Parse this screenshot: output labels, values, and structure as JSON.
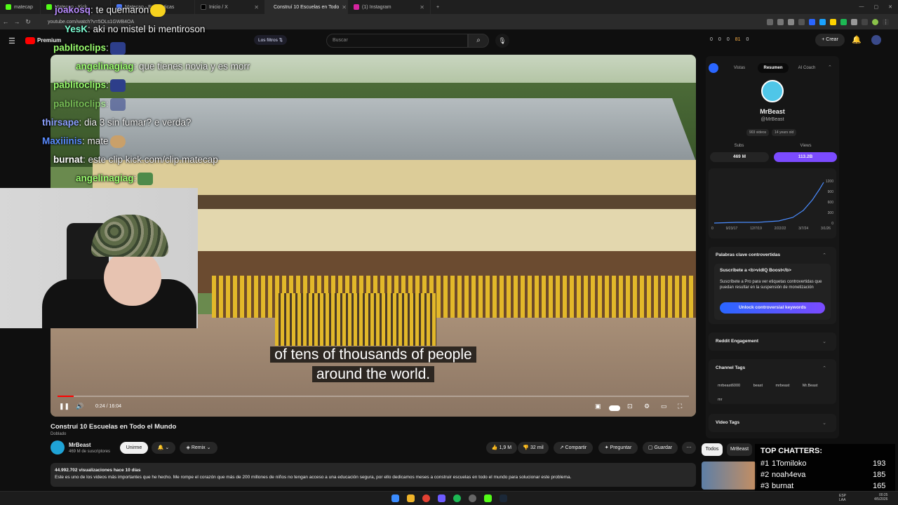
{
  "browser": {
    "tabs": [
      {
        "label": "matecap"
      },
      {
        "label": "Matecap - Kick"
      },
      {
        "label": "Matecap - Estadisticas"
      },
      {
        "label": "Inicio / X"
      },
      {
        "label": "Construí 10 Escuelas en Todo"
      },
      {
        "label": "(1) Instagram"
      }
    ],
    "url": "youtube.com/watch?v=5OLs1GWB4OA"
  },
  "youtube": {
    "logo_suffix": "Premium",
    "filters_label": "Los filtros",
    "search_placeholder": "Buscar",
    "create_label": "Crear",
    "stats": [
      "0",
      "0",
      "0",
      "81",
      "0"
    ]
  },
  "chat": [
    {
      "user": "joakosq",
      "text": ": te quemaron",
      "color": "#b98cff"
    },
    {
      "user": "YesK",
      "text": ": aki no mistel bi mentiroson",
      "color": "#7fffd4"
    },
    {
      "user": "pablitoclips",
      "text": ":",
      "color": "#9bff6f"
    },
    {
      "user": "angelinagiag",
      "text": ": que tienes novia y es morr",
      "color": "#9bff6f"
    },
    {
      "user": "pablitoclips",
      "text": ":",
      "color": "#9bff6f"
    },
    {
      "user": "pablitoclips",
      "text": ":",
      "color": "#9bff6f"
    },
    {
      "user": "thirsape",
      "text": ": dia 3 sin fumar? e verda?",
      "color": "#8ca0ff"
    },
    {
      "user": "Maxiiinis",
      "text": ": mate",
      "color": "#5a8bff"
    },
    {
      "user": "burnat",
      "text": ": este clip kick.com/clip.matecap",
      "color": "#ffffff"
    },
    {
      "user": "angelinagiag",
      "text": ":",
      "color": "#9bff6f"
    }
  ],
  "video": {
    "subtitle_line1": "of tens of thousands of people",
    "subtitle_line2": "around the world.",
    "time": "0:24 / 16:04",
    "progress": 0.025,
    "title": "Construí 10 Escuelas en Todo el Mundo",
    "dubbed": "Doblado",
    "channel": "MrBeast",
    "subscribers": "469 M de suscriptores",
    "join_label": "Unirme",
    "remix_label": "Remix",
    "likes": "1,9 M",
    "dislikes": "32 mil",
    "share_label": "Compartir",
    "ask_label": "Preguntar",
    "save_label": "Guardar",
    "views_date": "44.992.702 visualizaciones  hace 10 días",
    "description": "Este es uno de los videos más importantes que he hecho. Me rompe el corazón que más de 200 millones de niños no tengan acceso a una educación segura, por ello dedicamos meses a construir escuelas en todo el mundo para solucionar este problema."
  },
  "panel": {
    "tabs": [
      "Vistas",
      "Resumen",
      "AI Coach"
    ],
    "active_tab": "Resumen",
    "channel_name": "MrBeast",
    "handle": "@MrBeast",
    "videos_badge": "903 videos",
    "age_badge": "14 years old",
    "subs_label": "Subs",
    "subs_value": "469 M",
    "views_label": "Views",
    "views_value": "113.2B",
    "chart_y_ticks": [
      "1200",
      "900",
      "600",
      "300",
      "0"
    ],
    "chart_x_ticks": [
      "0",
      "9/23/17",
      "12/7/19",
      "2/22/22",
      "3/7/24",
      "3/1/26"
    ],
    "controversial_title": "Palabras clave controvertidas",
    "boost_title": "Suscríbete a <b>vidIQ Boost</b>",
    "boost_text": "Suscríbete a Pro para ver etiquetas controvertidas que puedan resultar en la suspensión de monetización",
    "unlock_label": "Unlock controversial keywords",
    "reddit_title": "Reddit Engagement",
    "tags_title": "Channel Tags",
    "tags": [
      "mrbeast6000",
      "beast",
      "mrbeast",
      "Mr.Beast",
      "mr"
    ],
    "video_tags_title": "Video Tags"
  },
  "chips": [
    "Todos",
    "MrBeast"
  ],
  "top_chatters": {
    "title": "TOP CHATTERS:",
    "entries": [
      {
        "rank": "#1",
        "name": "1Tomiloko",
        "count": "193"
      },
      {
        "rank": "#2",
        "name": "noah4eva",
        "count": "185"
      },
      {
        "rank": "#3",
        "name": "burnat",
        "count": "165"
      }
    ]
  },
  "taskbar": {
    "lang": "ESP\nLAA",
    "time": "00:25",
    "date": "4/5/2026"
  }
}
